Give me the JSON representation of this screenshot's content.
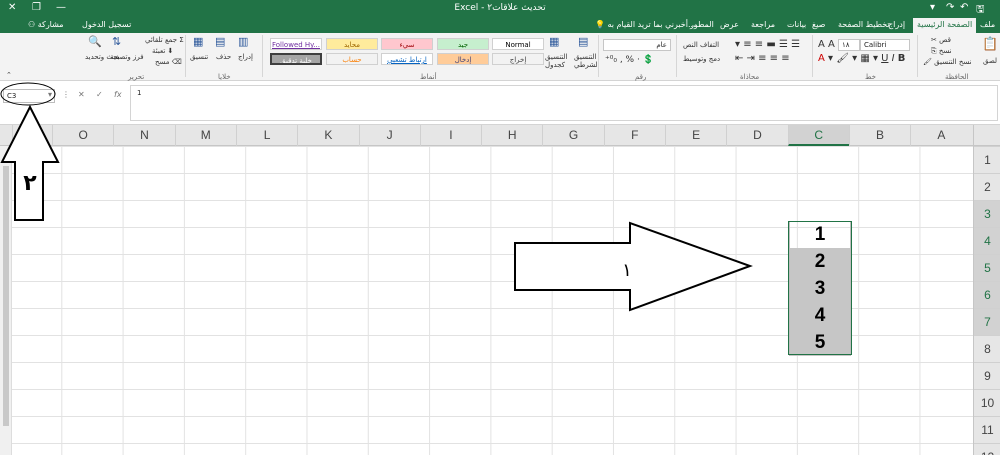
{
  "window": {
    "title": "Excel - تحديث علاقات٢",
    "signin": "تسجيل الدخول",
    "share": "مشاركة"
  },
  "tabs": [
    "ملف",
    "الصفحة الرئيسية",
    "إدراج",
    "تخطيط الصفحة",
    "صيغ",
    "بيانات",
    "مراجعة",
    "عرض",
    "المطور"
  ],
  "tell_me": "أخبرني بما تريد القيام به...",
  "ribbon": {
    "clipboard": {
      "paste": "لصق",
      "cut": "قص",
      "copy": "نسخ",
      "format_painter": "نسخ التنسيق",
      "label": "الحافظة"
    },
    "font": {
      "name": "Calibri",
      "size": "١٨",
      "label": "خط"
    },
    "alignment": {
      "wrap": "التفاف النص",
      "merge": "دمج وتوسيط",
      "label": "محاذاة"
    },
    "number": {
      "format": "عام",
      "label": "رقم"
    },
    "styles": {
      "conditional": "التنسيق الشرطي",
      "as_table": "التنسيق كجدول",
      "cells": [
        "Normal",
        "جيد",
        "سيء",
        "محايد",
        "Followed Hy...",
        "إخراج",
        "إدخال",
        "ارتباط تشعبي",
        "حساب",
        "خلية تدقيق"
      ],
      "label": "أنماط"
    },
    "cells_group": {
      "insert": "إدراج",
      "delete": "حذف",
      "format": "تنسيق",
      "label": "خلايا"
    },
    "editing": {
      "autosum": "جمع تلقائي",
      "fill": "تعبئة",
      "clear": "مسح",
      "sort": "فرز وتصفية",
      "find": "بحث وتحديد",
      "label": "تحرير"
    }
  },
  "formula": {
    "namebox": "C3",
    "value": "1",
    "fx": "fx"
  },
  "columns": [
    "P",
    "O",
    "N",
    "M",
    "L",
    "K",
    "J",
    "I",
    "H",
    "G",
    "F",
    "E",
    "D",
    "C",
    "B",
    "A"
  ],
  "selected_column": "C",
  "rows": [
    "1",
    "2",
    "3",
    "4",
    "5",
    "6",
    "7",
    "8",
    "9",
    "10",
    "11",
    "12"
  ],
  "selected_rows": [
    "3",
    "4",
    "5",
    "6",
    "7"
  ],
  "cell_values": [
    "1",
    "2",
    "3",
    "4",
    "5"
  ],
  "annotations": {
    "arrow1": "١",
    "arrow2": "٢"
  }
}
